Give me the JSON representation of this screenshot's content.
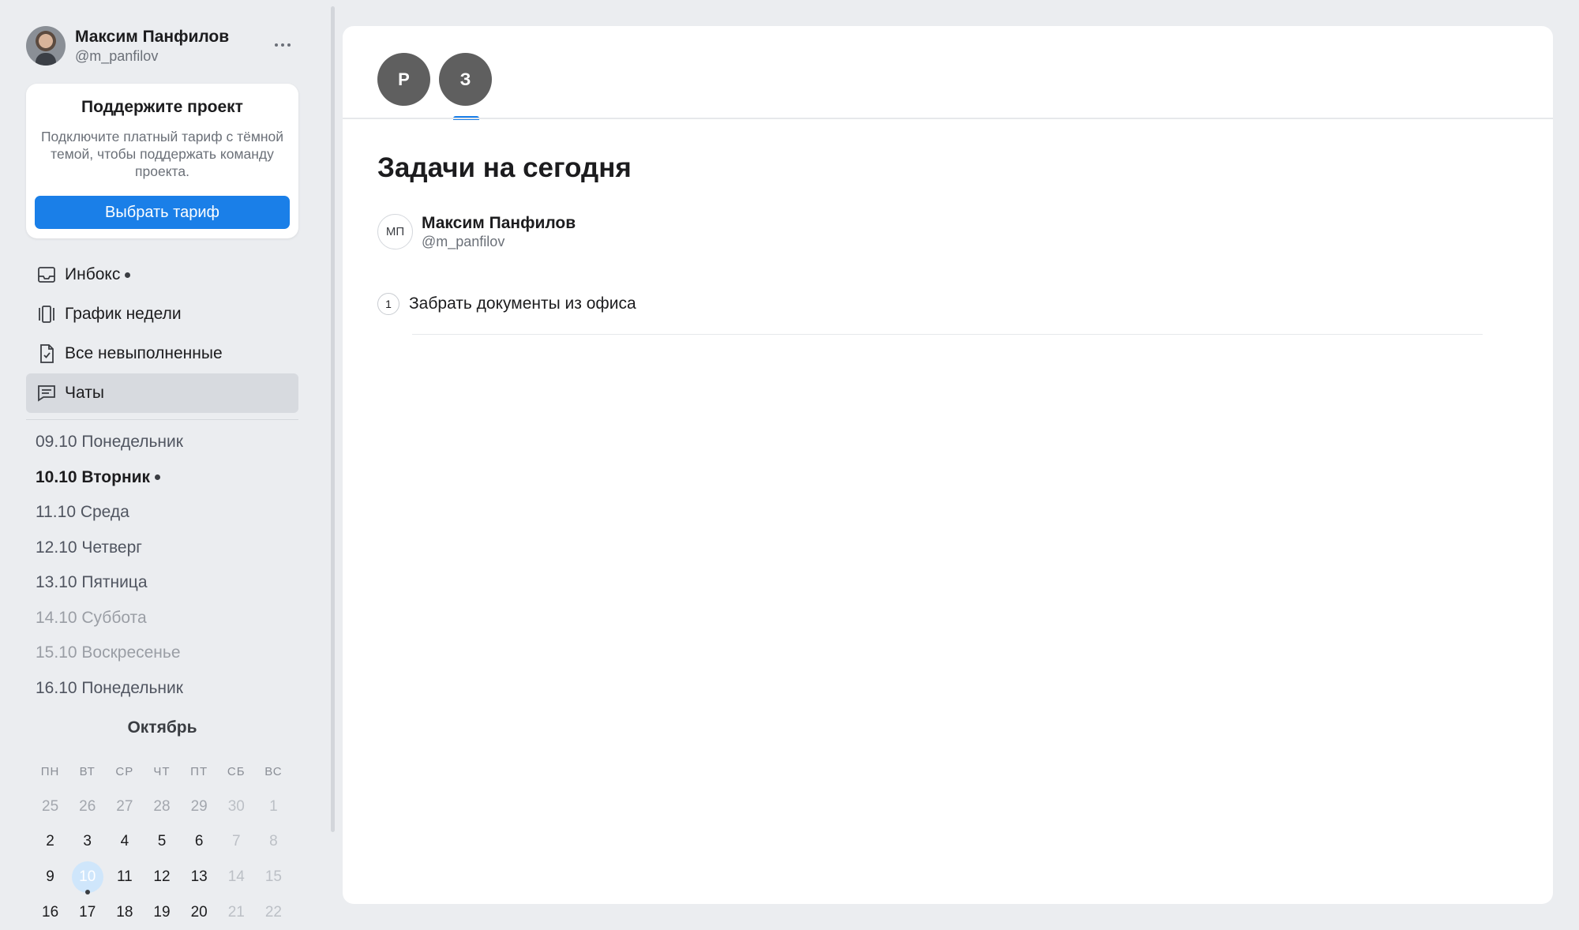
{
  "profile": {
    "name": "Максим Панфилов",
    "handle": "@m_panfilov"
  },
  "promo": {
    "title": "Поддержите проект",
    "text": "Подключите платный тариф с тёмной темой, чтобы поддержать команду проекта.",
    "button": "Выбрать тариф"
  },
  "nav": [
    {
      "label": "Инбокс",
      "icon": "inbox-icon",
      "has_dot": true
    },
    {
      "label": "График недели",
      "icon": "week-schedule-icon"
    },
    {
      "label": "Все невыполненные",
      "icon": "document-check-icon"
    },
    {
      "label": "Чаты",
      "icon": "chat-icon",
      "active": true
    }
  ],
  "days": [
    {
      "label": "09.10 Понедельник"
    },
    {
      "label": "10.10 Вторник",
      "today": true
    },
    {
      "label": "11.10 Среда"
    },
    {
      "label": "12.10 Четверг"
    },
    {
      "label": "13.10 Пятница"
    },
    {
      "label": "14.10 Суббота",
      "weekend": true
    },
    {
      "label": "15.10 Воскресенье",
      "weekend": true
    },
    {
      "label": "16.10 Понедельник"
    }
  ],
  "calendar": {
    "month": "Октябрь",
    "weekdays": [
      "ПН",
      "ВТ",
      "СР",
      "ЧТ",
      "ПТ",
      "СБ",
      "ВС"
    ],
    "weeks": [
      [
        "25",
        "26",
        "27",
        "28",
        "29",
        "30",
        "1"
      ],
      [
        "2",
        "3",
        "4",
        "5",
        "6",
        "7",
        "8"
      ],
      [
        "9",
        "10",
        "11",
        "12",
        "13",
        "14",
        "15"
      ],
      [
        "16",
        "17",
        "18",
        "19",
        "20",
        "21",
        "22"
      ]
    ],
    "today": "10"
  },
  "tabs": [
    {
      "label": "Р"
    },
    {
      "label": "З",
      "active": true
    }
  ],
  "main": {
    "title": "Задачи на сегодня",
    "author": {
      "initials": "МП",
      "name": "Максим Панфилов",
      "handle": "@m_panfilov"
    },
    "tasks": [
      {
        "number": "1",
        "text": "Забрать документы из офиса"
      }
    ]
  },
  "colors": {
    "accent": "#1a7fe8",
    "background": "#ebedf0",
    "active_nav": "#d7dadf",
    "tab_avatar": "#5f5f5f"
  }
}
